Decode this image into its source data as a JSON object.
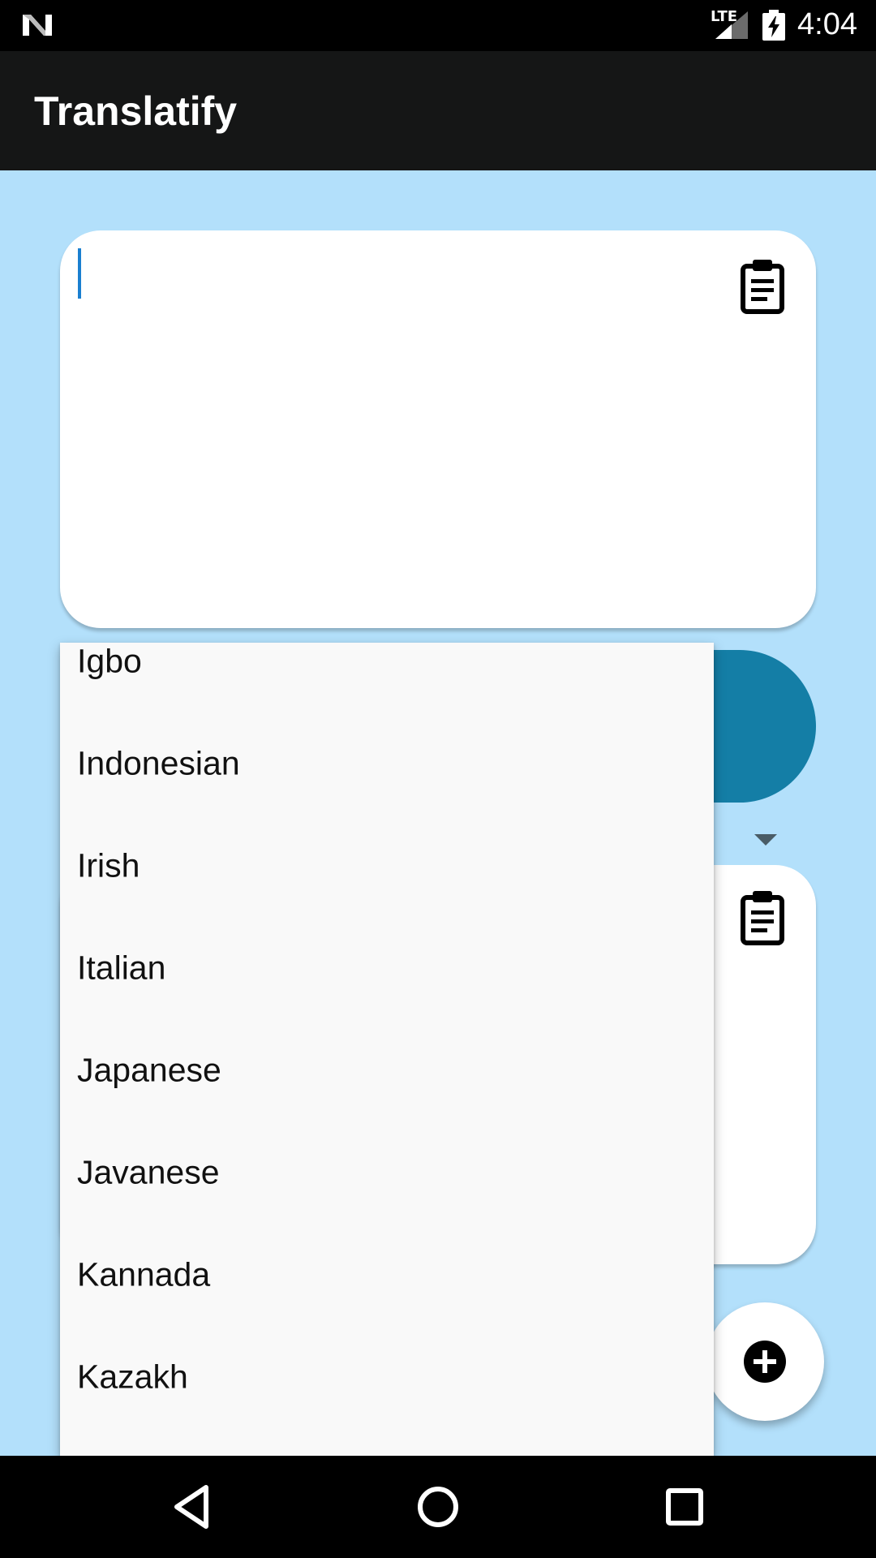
{
  "status_bar": {
    "network_label": "LTE",
    "time": "4:04"
  },
  "app_bar": {
    "title": "Translatify"
  },
  "input_card": {
    "text_value": "",
    "paste_icon": "clipboard-icon"
  },
  "output_card": {
    "paste_icon": "clipboard-icon"
  },
  "dropdown": {
    "items": [
      {
        "label": "Igbo"
      },
      {
        "label": "Indonesian"
      },
      {
        "label": "Irish"
      },
      {
        "label": "Italian"
      },
      {
        "label": "Japanese"
      },
      {
        "label": "Javanese"
      },
      {
        "label": "Kannada"
      },
      {
        "label": "Kazakh"
      }
    ]
  },
  "fab": {
    "icon": "add-circle-icon"
  },
  "nav_bar": {
    "back_icon": "back-triangle-icon",
    "home_icon": "home-circle-icon",
    "recents_icon": "recents-square-icon"
  },
  "colors": {
    "background": "#b3e0fb",
    "app_bar": "#151616",
    "translate_button": "#147ea6",
    "cursor": "#1a7fd0"
  }
}
